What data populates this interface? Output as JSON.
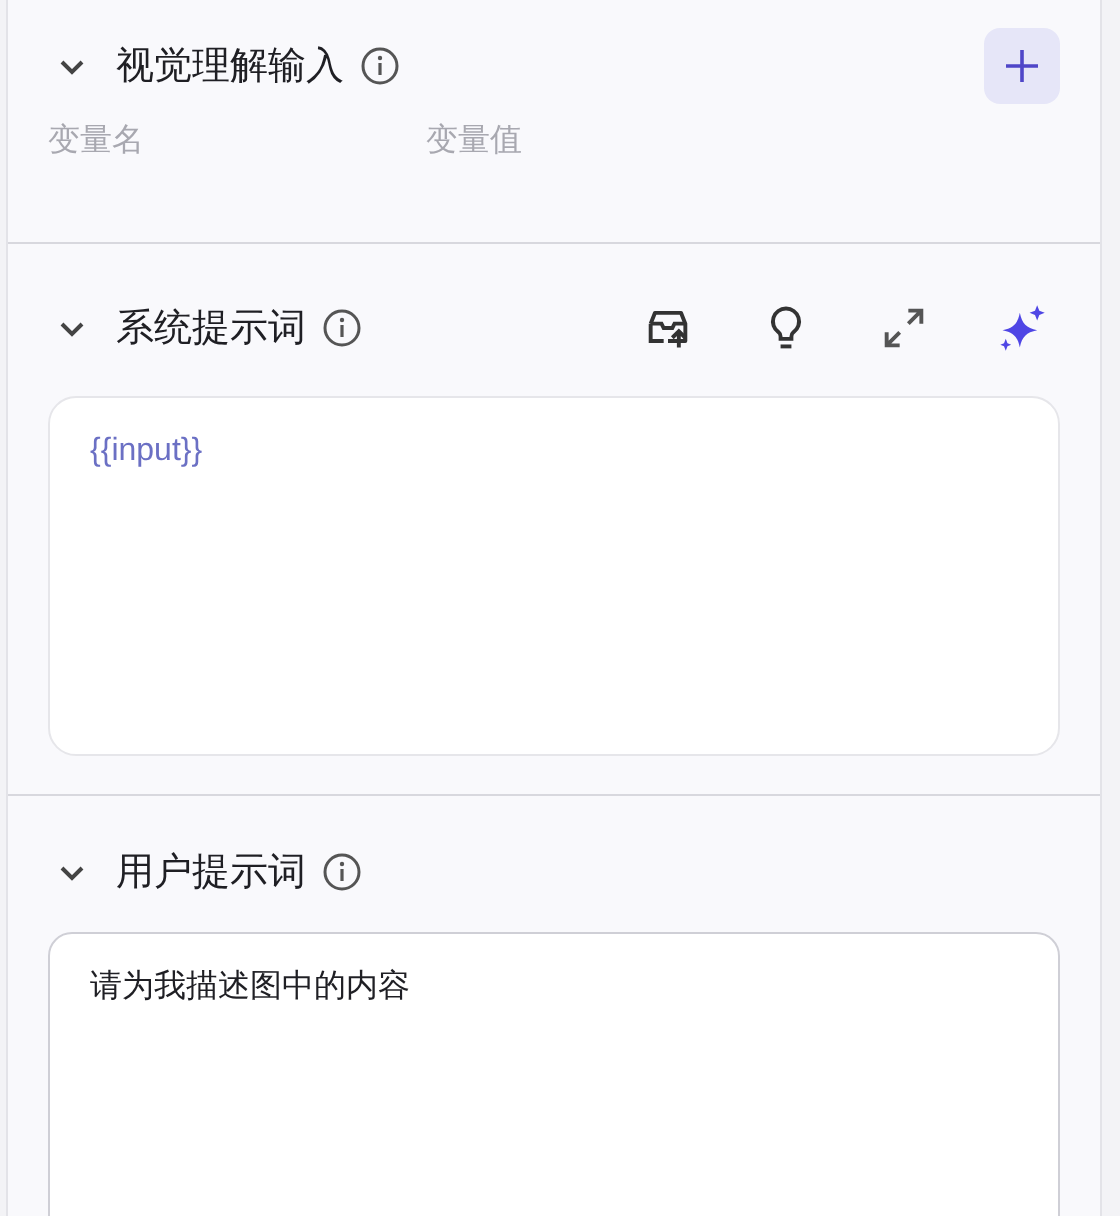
{
  "sections": [
    {
      "kind": "variables",
      "title": "视觉理解输入",
      "expanded": true,
      "columns": [
        "变量名",
        "变量值"
      ]
    },
    {
      "kind": "prompt",
      "title": "系统提示词",
      "expanded": true,
      "tools": [
        {
          "kind": "upload"
        },
        {
          "kind": "bulb"
        },
        {
          "kind": "expand"
        },
        {
          "kind": "sparkle"
        }
      ],
      "editor": {
        "kind": "variable",
        "value": "{{input}}"
      }
    },
    {
      "kind": "prompt",
      "title": "用户提示词",
      "expanded": true,
      "editor": {
        "kind": "text",
        "value": "请为我描述图中的内容"
      }
    }
  ]
}
